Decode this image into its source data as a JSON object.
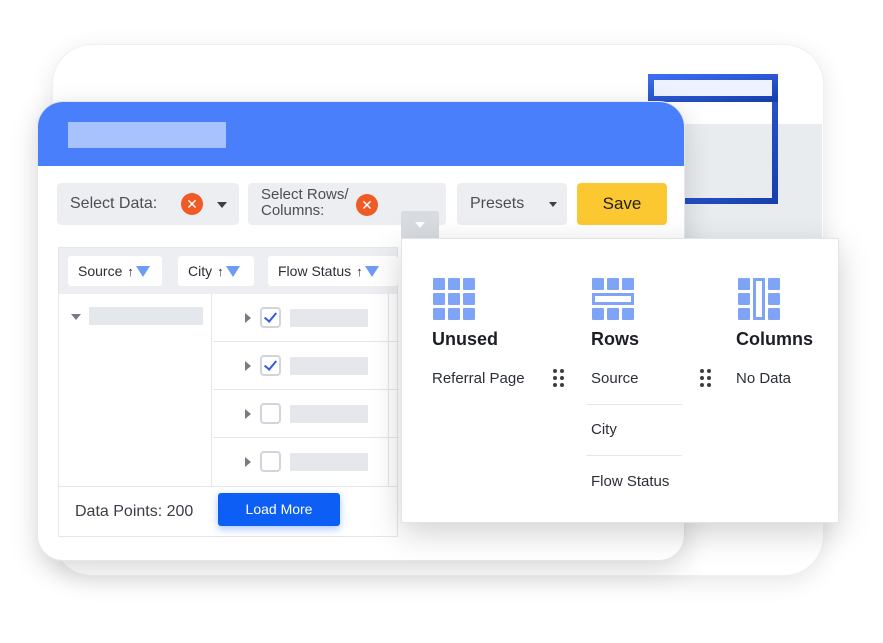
{
  "colors": {
    "header_blue": "#4a7ffc",
    "save_yellow": "#fcc831",
    "load_blue": "#0c5ef5",
    "clear_orange": "#f05a24",
    "icon_blue": "#7fa4f7",
    "sheet_blue": "#1f4fd0"
  },
  "toolbar": {
    "select_data_label": "Select Data:",
    "select_rows_label": "Select Rows/ Columns:",
    "presets_label": "Presets",
    "save_label": "Save",
    "clear_icon_glyph": "✕"
  },
  "grid": {
    "columns": [
      {
        "label": "Source",
        "sort_glyph": "↑",
        "icon": "filter-icon"
      },
      {
        "label": "City",
        "sort_glyph": "↑",
        "icon": "filter-icon"
      },
      {
        "label": "Flow Status",
        "sort_glyph": "↑",
        "icon": "filter-icon"
      }
    ],
    "rows": [
      {
        "checked": true
      },
      {
        "checked": true
      },
      {
        "checked": false
      },
      {
        "checked": false
      }
    ],
    "footer": {
      "data_points": "Data Points: 200",
      "load_more": "Load More"
    }
  },
  "layout_popup": {
    "unused": {
      "title": "Unused",
      "icon": "grid-icon",
      "items": [
        "Referral Page"
      ]
    },
    "rows": {
      "title": "Rows",
      "icon": "rows-icon",
      "items": [
        "Source",
        "City",
        "Flow Status"
      ]
    },
    "columns": {
      "title": "Columns",
      "icon": "columns-icon",
      "items": [
        "No Data"
      ]
    }
  }
}
